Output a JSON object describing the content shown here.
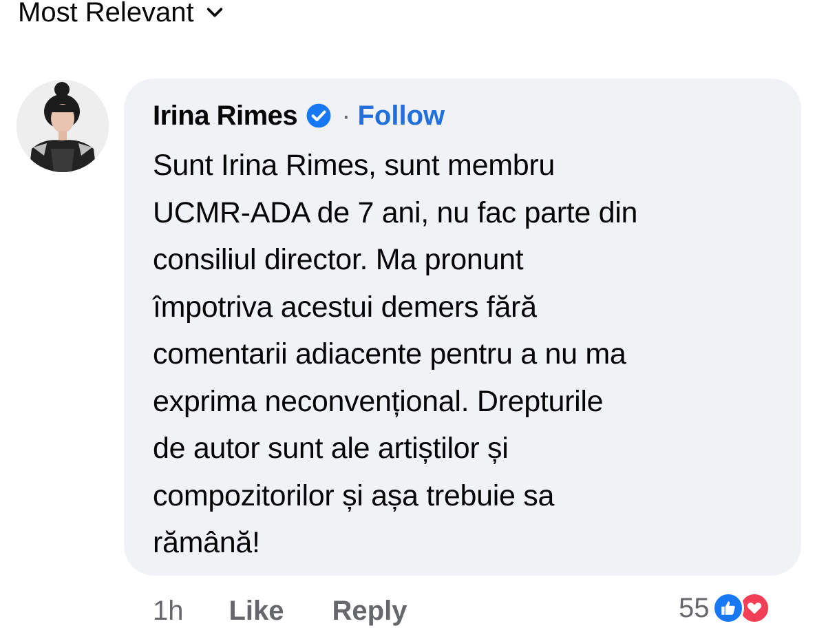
{
  "sort": {
    "label": "Most Relevant"
  },
  "comment": {
    "author": "Irina Rimes",
    "separator": "·",
    "follow_label": "Follow",
    "lines": [
      "Sunt Irina Rimes, sunt membru",
      "UCMR-ADA de 7 ani, nu fac parte din",
      "consiliul director. Ma pronunt",
      "împotriva acestui demers fără",
      "comentarii adiacente pentru a nu ma",
      "exprima neconvențional. Drepturile",
      "de autor sunt ale artiștilor și",
      "compozitorilor și așa trebuie sa",
      "rămână!"
    ],
    "timestamp": "1h",
    "like_label": "Like",
    "reply_label": "Reply",
    "reaction_count": "55",
    "reactions": [
      "like-icon",
      "love-icon"
    ]
  },
  "colors": {
    "bubble": "#f0f2f5",
    "follow": "#216fdb",
    "verified": "#1877f2",
    "secondary_text": "#65676b",
    "like": "#1877f2",
    "love": "#f33e58"
  }
}
